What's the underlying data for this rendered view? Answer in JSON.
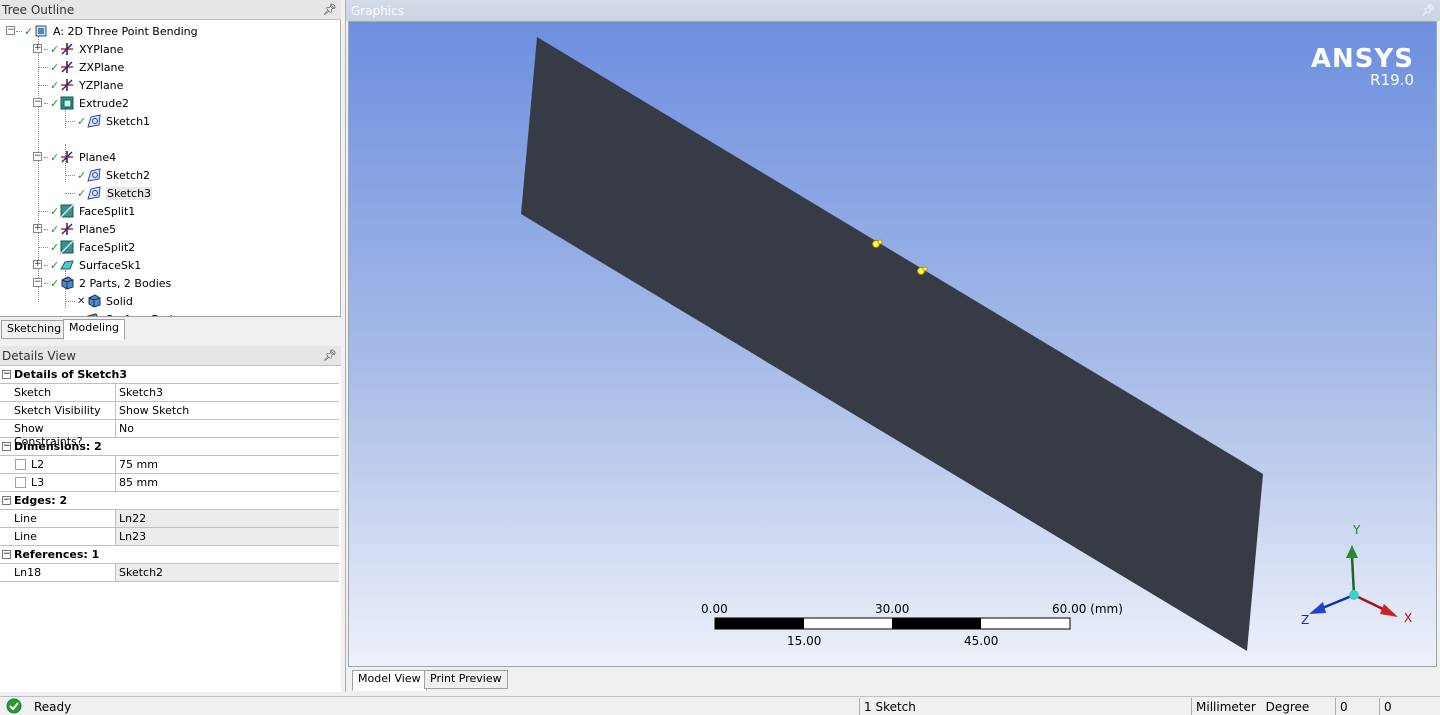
{
  "tree_outline": {
    "title": "Tree Outline",
    "items": [
      {
        "label": "A: 2D Three Point Bending"
      },
      {
        "label": "XYPlane"
      },
      {
        "label": "ZXPlane"
      },
      {
        "label": "YZPlane"
      },
      {
        "label": "Extrude2"
      },
      {
        "label": "Sketch1"
      },
      {
        "label": "Plane4"
      },
      {
        "label": "Sketch2"
      },
      {
        "label": "Sketch3"
      },
      {
        "label": "FaceSplit1"
      },
      {
        "label": "Plane5"
      },
      {
        "label": "FaceSplit2"
      },
      {
        "label": "SurfaceSk1"
      },
      {
        "label": "2 Parts, 2 Bodies"
      },
      {
        "label": "Solid"
      },
      {
        "label": "Surface Body"
      }
    ],
    "tabs": [
      "Sketching",
      "Modeling"
    ],
    "active_tab": "Modeling"
  },
  "details_view": {
    "title": "Details View",
    "groups": [
      {
        "title": "Details of Sketch3",
        "rows": [
          {
            "key": "Sketch",
            "value": "Sketch3"
          },
          {
            "key": "Sketch Visibility",
            "value": "Show Sketch"
          },
          {
            "key": "Show Constraints?",
            "value": "No"
          }
        ]
      },
      {
        "title": "Dimensions: 2",
        "rows": [
          {
            "key": "L2",
            "value": "75 mm"
          },
          {
            "key": "L3",
            "value": "85 mm"
          }
        ]
      },
      {
        "title": "Edges: 2",
        "rows": [
          {
            "key": "Line",
            "value": "Ln22"
          },
          {
            "key": "Line",
            "value": "Ln23"
          }
        ]
      },
      {
        "title": "References: 1",
        "rows": [
          {
            "key": "Ln18",
            "value": "Sketch2"
          }
        ]
      }
    ]
  },
  "graphics": {
    "title": "Graphics",
    "logo": "ANSYS",
    "version": "R19.0",
    "scale": {
      "t0": "0.00",
      "t30": "30.00",
      "t60": "60.00 (mm)",
      "t15": "15.00",
      "t45": "45.00"
    },
    "triad": {
      "x": "X",
      "y": "Y",
      "z": "Z"
    },
    "tabs": [
      "Model View",
      "Print Preview"
    ],
    "active_tab": "Model View"
  },
  "status_bar": {
    "state": "Ready",
    "selection": "1 Sketch",
    "length_unit": "Millimeter",
    "angle_unit": "Degree",
    "field1": "0",
    "field2": "0"
  },
  "colors": {
    "plate": "#363b45",
    "viewport_top": "#6d8fdf",
    "viewport_bottom": "#eef1fa",
    "check": "#1a9a1a"
  }
}
